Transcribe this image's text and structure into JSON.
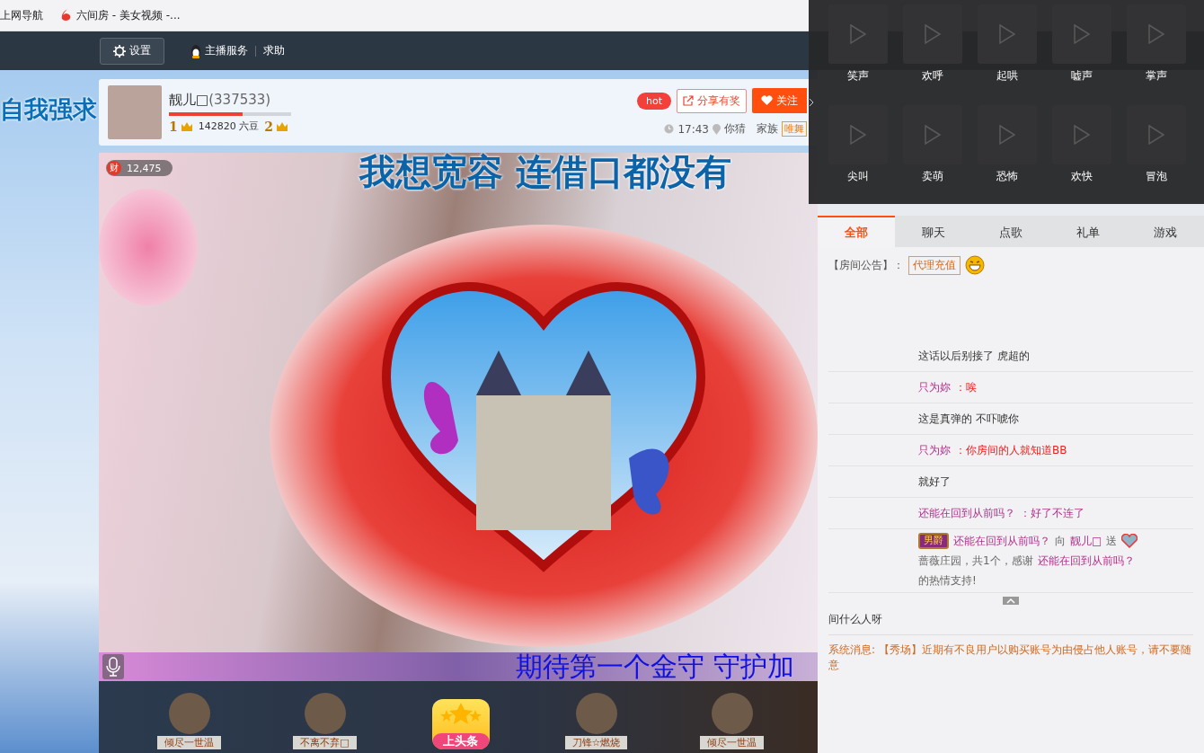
{
  "bookmarks": [
    {
      "label": "上网导航",
      "kind": "plain"
    },
    {
      "label": "六间房 - 美女视频 -...",
      "kind": "site"
    }
  ],
  "nav": {
    "settings": "设置",
    "anchor_service": "主播服务",
    "help": "求助"
  },
  "danmaku": "自我强求",
  "host": {
    "name": "靓儿□",
    "room_id": "(337533)",
    "level": 0.6,
    "rank_from": "1",
    "beans": "142820 六豆",
    "rank_to": "2",
    "hot": "hot",
    "share": "分享有奖",
    "follow": "关注",
    "time": "17:43",
    "location": "你猜",
    "family_label": "家族",
    "family": "唯舞"
  },
  "video": {
    "wealth": "财",
    "viewers": "12,475",
    "caption": "我想宽容 连借口都没有",
    "ticker": "期待第一个金守  守护加"
  },
  "guardians": [
    {
      "name": "倾尽一世温",
      "kind": "avatar"
    },
    {
      "name": "不离不弃□",
      "kind": "avatar"
    },
    {
      "name": "上头条",
      "kind": "promo"
    },
    {
      "name": "刀锋☆燃烧",
      "kind": "avatar"
    },
    {
      "name": "倾尽一世温",
      "kind": "avatar"
    }
  ],
  "sound_effects": [
    "笑声",
    "欢呼",
    "起哄",
    "嘘声",
    "掌声",
    "尖叫",
    "卖萌",
    "恐怖",
    "欢快",
    "冒泡"
  ],
  "tabs": [
    {
      "label": "全部",
      "selected": true
    },
    {
      "label": "聊天",
      "selected": false
    },
    {
      "label": "点歌",
      "selected": false
    },
    {
      "label": "礼单",
      "selected": false
    },
    {
      "label": "游戏",
      "selected": false
    }
  ],
  "announcement": {
    "label": "【房间公告】：",
    "link": "代理充值"
  },
  "chat": [
    {
      "segments": [
        {
          "text": "这话以后别接了 虎超的",
          "kind": "text"
        }
      ]
    },
    {
      "segments": [
        {
          "text": "只为妳",
          "kind": "user"
        },
        {
          "text": "：唉",
          "kind": "alert"
        }
      ]
    },
    {
      "segments": [
        {
          "text": "这是真弹的 不吓唬你",
          "kind": "text"
        }
      ]
    },
    {
      "segments": [
        {
          "text": "只为妳",
          "kind": "user"
        },
        {
          "text": "：你房间的人就知道BB",
          "kind": "alert"
        }
      ]
    },
    {
      "segments": [
        {
          "text": "就好了",
          "kind": "text"
        }
      ]
    },
    {
      "segments": [
        {
          "text": "还能在回到从前吗？",
          "kind": "user"
        },
        {
          "text": "：好了不连了",
          "kind": "user"
        }
      ]
    },
    {
      "badge": "男爵",
      "segments": [
        {
          "text": "还能在回到从前吗？",
          "kind": "user"
        },
        {
          "text": "向",
          "kind": "muted"
        },
        {
          "text": "靓儿□",
          "kind": "user"
        },
        {
          "text": "送",
          "kind": "muted"
        },
        {
          "kind": "gift"
        },
        {
          "text": "蔷薇庄园，共1个，感谢",
          "kind": "muted"
        },
        {
          "text": "还能在回到从前吗？",
          "kind": "user"
        },
        {
          "text": "的热情支持!",
          "kind": "muted"
        }
      ]
    }
  ],
  "bottom_messages": [
    {
      "text": "间什么人呀",
      "kind": "chat"
    },
    {
      "text": "系统消息: 【秀场】近期有不良用户以购买账号为由侵占他人账号，请不要随意",
      "kind": "system"
    }
  ]
}
